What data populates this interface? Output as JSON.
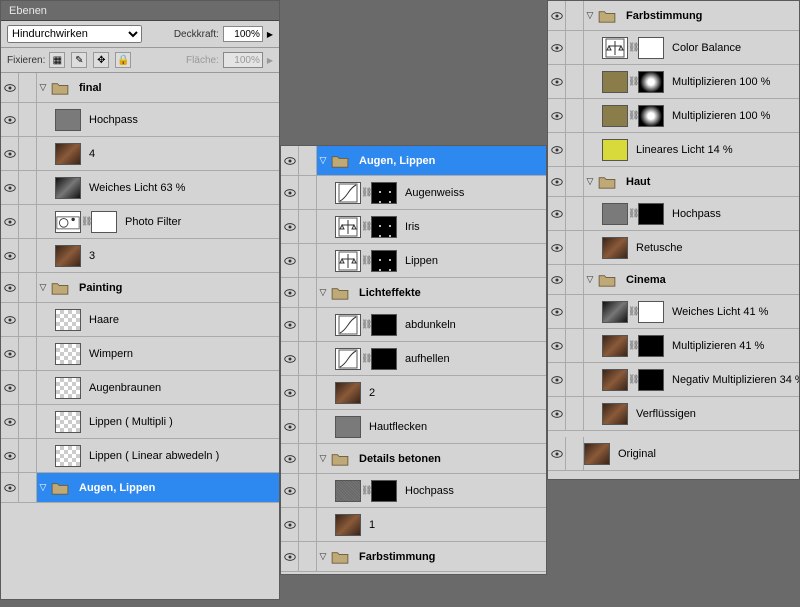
{
  "hdr": {
    "title": "Ebenen"
  },
  "blend": {
    "mode": "Hindurchwirken",
    "opacityLabel": "Deckkraft:",
    "opacity": "100%",
    "lockLabel": "Fixieren:",
    "fillLabel": "Fläche:",
    "fill": "100%"
  },
  "p1": {
    "g_final": "final",
    "hochpass": "Hochpass",
    "l4": "4",
    "weiches": "Weiches Licht 63 %",
    "photofilter": "Photo Filter",
    "l3": "3",
    "g_painting": "Painting",
    "haare": "Haare",
    "wimpern": "Wimpern",
    "augenbraunen": "Augenbraunen",
    "lippen_mult": "Lippen ( Multipli )",
    "lippen_lin": "Lippen ( Linear abwedeln )",
    "g_augen": "Augen, Lippen"
  },
  "p2": {
    "g_augen": "Augen, Lippen",
    "augenweiss": "Augenweiss",
    "iris": "Iris",
    "lippen": "Lippen",
    "g_licht": "Lichteffekte",
    "abdunkeln": "abdunkeln",
    "aufhellen": "aufhellen",
    "l2": "2",
    "hautflecken": "Hautflecken",
    "g_details": "Details betonen",
    "hochpass": "Hochpass",
    "l1": "1",
    "g_farb": "Farbstimmung"
  },
  "p3": {
    "g_farb": "Farbstimmung",
    "colorbalance": "Color Balance",
    "mult1": "Multiplizieren 100 %",
    "mult2": "Multiplizieren 100 %",
    "linlicht": "Lineares Licht 14 %",
    "g_haut": "Haut",
    "hochpass": "Hochpass",
    "retusche": "Retusche",
    "g_cinema": "Cinema",
    "weiches41": "Weiches Licht 41 %",
    "mult41": "Multiplizieren 41 %",
    "negmult": "Negativ Multiplizieren 34 %",
    "verfl": "Verflüssigen",
    "original": "Original"
  }
}
